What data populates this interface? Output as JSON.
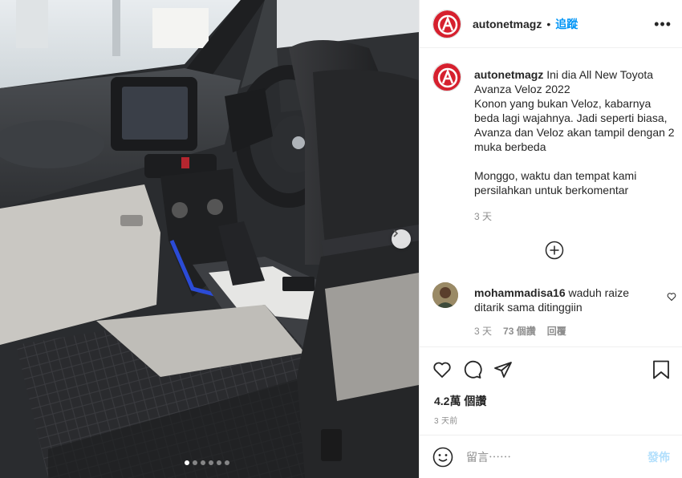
{
  "post": {
    "author": "autonetmagz",
    "follow_separator": "•",
    "follow_label": "追蹤",
    "more_label": "•••",
    "caption_text": "Ini dia All New Toyota Avanza Veloz 2022\nKonon yang bukan Veloz, kabarnya beda lagi wajahnya. Jadi seperti biasa, Avanza dan Veloz akan tampil dengan 2 muka berbeda\n\nMonggo, waktu dan tempat kami persilahkan untuk berkomentar",
    "caption_time": "3 天",
    "carousel": {
      "total": 6,
      "active_index": 0
    }
  },
  "comments": [
    {
      "user": "mohammadisa16",
      "text": "waduh raize ditarik sama ditinggiin",
      "time": "3 天",
      "likes": "73 個讚",
      "reply": "回覆"
    }
  ],
  "footer": {
    "likes": "4.2萬 個讚",
    "date": "3 天前",
    "comment_placeholder": "留言⋯⋯",
    "post_label": "發佈"
  },
  "icons": {
    "like": "heart-icon",
    "comment": "comment-icon",
    "share": "share-icon",
    "save": "bookmark-icon",
    "load_more": "plus-circle-icon",
    "emoji": "emoji-icon",
    "next": "chevron-right-icon"
  },
  "colors": {
    "accent": "#0095f6",
    "brand_red": "#d6202e",
    "muted": "#8e8e8e"
  }
}
